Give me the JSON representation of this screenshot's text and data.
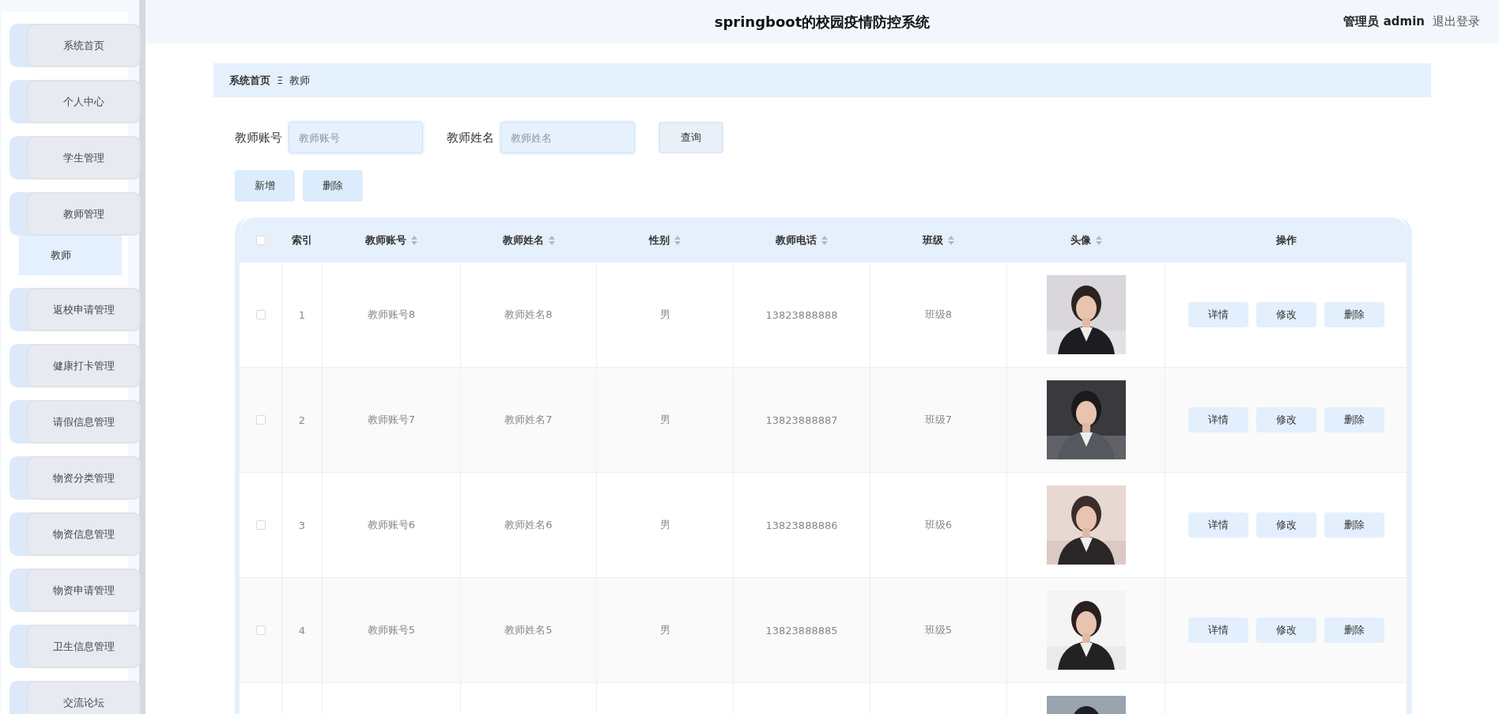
{
  "header": {
    "title": "springboot的校园疫情防控系统",
    "user": "管理员 admin",
    "logout": "退出登录"
  },
  "sidebar": {
    "items": [
      {
        "label": "系统首页"
      },
      {
        "label": "个人中心"
      },
      {
        "label": "学生管理"
      },
      {
        "label": "教师管理",
        "children": [
          {
            "label": "教师",
            "selected": true
          }
        ]
      },
      {
        "label": "返校申请管理"
      },
      {
        "label": "健康打卡管理"
      },
      {
        "label": "请假信息管理"
      },
      {
        "label": "物资分类管理"
      },
      {
        "label": "物资信息管理"
      },
      {
        "label": "物资申请管理"
      },
      {
        "label": "卫生信息管理"
      },
      {
        "label": "交流论坛"
      }
    ]
  },
  "breadcrumb": {
    "items": [
      "系统首页",
      "教师"
    ],
    "separator": "Ξ"
  },
  "search": {
    "fields": [
      {
        "label": "教师账号",
        "placeholder": "教师账号"
      },
      {
        "label": "教师姓名",
        "placeholder": "教师姓名"
      }
    ],
    "button": "查询"
  },
  "actions": [
    "新增",
    "删除"
  ],
  "table": {
    "select_all_checked": false,
    "columns": [
      {
        "label": "索引",
        "sortable": false
      },
      {
        "label": "教师账号",
        "sortable": true
      },
      {
        "label": "教师姓名",
        "sortable": true
      },
      {
        "label": "性别",
        "sortable": true
      },
      {
        "label": "教师电话",
        "sortable": true
      },
      {
        "label": "班级",
        "sortable": true
      },
      {
        "label": "头像",
        "sortable": true
      },
      {
        "label": "操作",
        "sortable": false
      }
    ],
    "rows": [
      {
        "checked": false,
        "cells": [
          "1",
          "教师账号8",
          "教师姓名8",
          "男",
          "13823888888",
          "班级8"
        ],
        "avatar": {
          "kind": "picture"
        },
        "buttons": [
          "详情",
          "修改",
          "删除"
        ]
      },
      {
        "checked": false,
        "cells": [
          "2",
          "教师账号7",
          "教师姓名7",
          "男",
          "13823888887",
          "班级7"
        ],
        "avatar": {
          "kind": "picture"
        },
        "buttons": [
          "详情",
          "修改",
          "删除"
        ]
      },
      {
        "checked": false,
        "cells": [
          "3",
          "教师账号6",
          "教师姓名6",
          "男",
          "13823888886",
          "班级6"
        ],
        "avatar": {
          "kind": "picture"
        },
        "buttons": [
          "详情",
          "修改",
          "删除"
        ]
      },
      {
        "checked": false,
        "cells": [
          "4",
          "教师账号5",
          "教师姓名5",
          "男",
          "13823888885",
          "班级5"
        ],
        "avatar": {
          "kind": "picture"
        },
        "buttons": [
          "详情",
          "修改",
          "删除"
        ]
      },
      {
        "avatar": {
          "kind": "picture"
        }
      }
    ]
  }
}
